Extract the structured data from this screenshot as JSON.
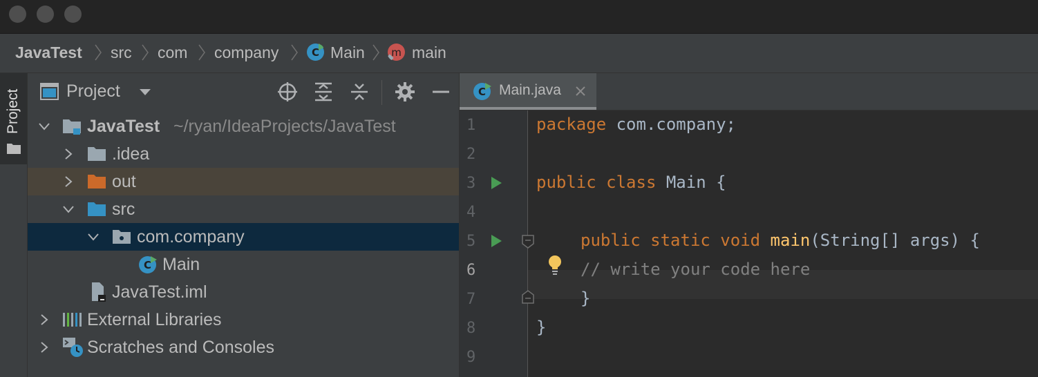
{
  "breadcrumb": {
    "project": "JavaTest",
    "items": [
      "src",
      "com",
      "company"
    ],
    "class": "Main",
    "method": "main"
  },
  "project_panel": {
    "title": "Project",
    "stripe_label": "Project",
    "tree": [
      {
        "label": "JavaTest",
        "path": "~/ryan/IdeaProjects/JavaTest"
      },
      {
        "label": ".idea"
      },
      {
        "label": "out"
      },
      {
        "label": "src"
      },
      {
        "label": "com.company"
      },
      {
        "label": "Main"
      },
      {
        "label": "JavaTest.iml"
      },
      {
        "label": "External Libraries"
      },
      {
        "label": "Scratches and Consoles"
      }
    ]
  },
  "editor": {
    "tab_label": "Main.java",
    "line_numbers": [
      "1",
      "2",
      "3",
      "4",
      "5",
      "6",
      "7",
      "8",
      "9"
    ],
    "code": {
      "l1_kw": "package",
      "l1_rest": " com.company;",
      "l3_kw": "public class",
      "l3_rest": " Main {",
      "l5_kw": "public static void",
      "l5_fn": "main",
      "l5_rest": "(String[] args) {",
      "l6_comment": "// write your code here",
      "l7": "}",
      "l8": "}"
    }
  },
  "colors": {
    "keyword": "#cc7832",
    "function": "#ffc66d",
    "comment": "#808080",
    "selection": "#0d293e",
    "excluded_row": "#4a443a"
  }
}
